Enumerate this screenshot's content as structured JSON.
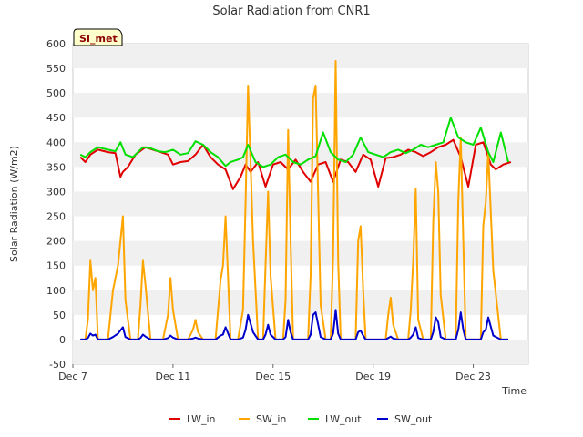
{
  "chart_data": {
    "type": "line",
    "title": "Solar Radiation from CNR1",
    "xlabel": "Time",
    "ylabel": "Solar Radiation (W/m2)",
    "site_badge": "SI_met",
    "ylim": [
      -50,
      600
    ],
    "xlim": [
      0,
      18.2
    ],
    "y_ticks": [
      -50,
      0,
      50,
      100,
      150,
      200,
      250,
      300,
      350,
      400,
      450,
      500,
      550,
      600
    ],
    "x_ticks": [
      {
        "value": 0,
        "label": "Dec 7"
      },
      {
        "value": 4,
        "label": "Dec 11"
      },
      {
        "value": 8,
        "label": "Dec 15"
      },
      {
        "value": 12,
        "label": "Dec 19"
      },
      {
        "value": 16,
        "label": "Dec 23"
      }
    ],
    "grid": true,
    "legend_position": "bottom",
    "series": [
      {
        "name": "LW_in",
        "color": "#e00000",
        "x": [
          0.3,
          0.5,
          0.7,
          1.0,
          1.4,
          1.7,
          1.9,
          2.0,
          2.2,
          2.5,
          2.9,
          3.2,
          3.5,
          3.8,
          4.0,
          4.3,
          4.6,
          4.9,
          5.2,
          5.5,
          5.8,
          6.1,
          6.4,
          6.7,
          6.9,
          7.1,
          7.4,
          7.7,
          8.0,
          8.3,
          8.6,
          8.9,
          9.2,
          9.5,
          9.8,
          10.1,
          10.4,
          10.7,
          11.0,
          11.3,
          11.6,
          11.9,
          12.2,
          12.5,
          12.8,
          13.1,
          13.4,
          13.7,
          14.0,
          14.3,
          14.6,
          14.9,
          15.2,
          15.5,
          15.8,
          16.1,
          16.4,
          16.7,
          16.9,
          17.2,
          17.5
        ],
        "values": [
          370,
          360,
          375,
          385,
          380,
          378,
          330,
          340,
          350,
          375,
          390,
          385,
          380,
          375,
          355,
          360,
          362,
          375,
          395,
          370,
          355,
          345,
          305,
          330,
          355,
          340,
          360,
          310,
          355,
          360,
          345,
          365,
          340,
          320,
          355,
          360,
          320,
          365,
          360,
          340,
          375,
          365,
          310,
          368,
          370,
          375,
          385,
          380,
          372,
          380,
          390,
          395,
          405,
          370,
          310,
          395,
          400,
          355,
          345,
          355,
          360
        ]
      },
      {
        "name": "SW_in",
        "color": "#ffa500",
        "x": [
          0.3,
          0.5,
          0.6,
          0.7,
          0.8,
          0.9,
          1.0,
          1.2,
          1.4,
          1.6,
          1.8,
          2.0,
          2.1,
          2.3,
          2.6,
          2.7,
          2.8,
          2.9,
          3.1,
          3.6,
          3.8,
          3.9,
          4.0,
          4.2,
          4.6,
          4.8,
          4.9,
          5.0,
          5.2,
          5.7,
          5.9,
          6.0,
          6.1,
          6.3,
          6.6,
          6.8,
          6.9,
          7.0,
          7.2,
          7.4,
          7.6,
          7.7,
          7.8,
          7.9,
          8.1,
          8.4,
          8.5,
          8.6,
          8.7,
          8.8,
          9.1,
          9.4,
          9.5,
          9.6,
          9.7,
          9.9,
          10.1,
          10.3,
          10.4,
          10.5,
          10.6,
          10.7,
          10.9,
          11.3,
          11.4,
          11.5,
          11.6,
          11.7,
          11.9,
          12.2,
          12.5,
          12.6,
          12.7,
          12.8,
          13.0,
          13.4,
          13.5,
          13.6,
          13.7,
          13.8,
          14.0,
          14.3,
          14.4,
          14.5,
          14.6,
          14.7,
          14.9,
          15.3,
          15.4,
          15.5,
          15.6,
          15.7,
          15.9,
          16.3,
          16.4,
          16.5,
          16.6,
          16.8,
          17.1,
          17.4
        ],
        "values": [
          0,
          0,
          40,
          160,
          100,
          125,
          0,
          0,
          0,
          100,
          150,
          250,
          80,
          0,
          0,
          70,
          160,
          110,
          0,
          0,
          50,
          125,
          60,
          0,
          0,
          20,
          40,
          15,
          0,
          0,
          120,
          150,
          250,
          0,
          0,
          60,
          280,
          515,
          200,
          0,
          0,
          150,
          300,
          130,
          0,
          0,
          80,
          425,
          200,
          0,
          0,
          0,
          130,
          490,
          515,
          70,
          0,
          0,
          170,
          565,
          160,
          0,
          0,
          0,
          200,
          230,
          100,
          0,
          0,
          0,
          0,
          50,
          85,
          30,
          0,
          0,
          60,
          160,
          305,
          40,
          0,
          0,
          240,
          360,
          300,
          90,
          0,
          0,
          280,
          410,
          200,
          0,
          0,
          0,
          230,
          280,
          380,
          140,
          0,
          0
        ]
      },
      {
        "name": "LW_out",
        "color": "#00e000",
        "x": [
          0.3,
          0.5,
          0.7,
          1.0,
          1.4,
          1.7,
          1.9,
          2.1,
          2.4,
          2.8,
          3.1,
          3.4,
          3.7,
          4.0,
          4.3,
          4.6,
          4.9,
          5.2,
          5.5,
          5.8,
          6.1,
          6.3,
          6.6,
          6.8,
          7.0,
          7.3,
          7.6,
          7.9,
          8.2,
          8.5,
          8.8,
          9.1,
          9.4,
          9.7,
          10.0,
          10.3,
          10.6,
          10.9,
          11.2,
          11.5,
          11.8,
          12.1,
          12.4,
          12.7,
          13.0,
          13.3,
          13.6,
          13.9,
          14.2,
          14.5,
          14.8,
          15.1,
          15.4,
          15.7,
          16.0,
          16.3,
          16.6,
          16.8,
          17.1,
          17.4
        ],
        "values": [
          375,
          370,
          380,
          390,
          385,
          382,
          400,
          375,
          370,
          390,
          388,
          382,
          380,
          385,
          375,
          378,
          402,
          395,
          380,
          370,
          352,
          360,
          365,
          370,
          395,
          360,
          350,
          355,
          370,
          375,
          360,
          355,
          365,
          372,
          420,
          380,
          365,
          360,
          375,
          410,
          380,
          375,
          370,
          380,
          385,
          378,
          385,
          395,
          390,
          395,
          400,
          450,
          410,
          400,
          395,
          430,
          380,
          360,
          420,
          360
        ]
      },
      {
        "name": "SW_out",
        "color": "#0000cc",
        "x": [
          0.3,
          0.5,
          0.6,
          0.7,
          0.8,
          0.9,
          1.0,
          1.2,
          1.4,
          1.6,
          1.8,
          2.0,
          2.1,
          2.3,
          2.6,
          2.7,
          2.8,
          2.9,
          3.1,
          3.6,
          3.8,
          3.9,
          4.0,
          4.2,
          4.6,
          4.8,
          4.9,
          5.0,
          5.2,
          5.7,
          5.9,
          6.0,
          6.1,
          6.3,
          6.6,
          6.8,
          6.9,
          7.0,
          7.2,
          7.4,
          7.6,
          7.7,
          7.8,
          7.9,
          8.1,
          8.4,
          8.5,
          8.6,
          8.7,
          8.8,
          9.1,
          9.4,
          9.5,
          9.6,
          9.7,
          9.9,
          10.1,
          10.3,
          10.4,
          10.5,
          10.6,
          10.7,
          10.9,
          11.3,
          11.4,
          11.5,
          11.6,
          11.7,
          11.9,
          12.2,
          12.5,
          12.6,
          12.7,
          12.8,
          13.0,
          13.4,
          13.5,
          13.6,
          13.7,
          13.8,
          14.0,
          14.3,
          14.4,
          14.5,
          14.6,
          14.7,
          14.9,
          15.3,
          15.4,
          15.5,
          15.6,
          15.7,
          15.9,
          16.3,
          16.4,
          16.5,
          16.6,
          16.8,
          17.1,
          17.4
        ],
        "values": [
          0,
          0,
          3,
          12,
          8,
          10,
          0,
          0,
          0,
          5,
          12,
          25,
          5,
          0,
          0,
          3,
          10,
          6,
          0,
          0,
          3,
          8,
          4,
          0,
          0,
          2,
          4,
          2,
          0,
          0,
          8,
          10,
          25,
          0,
          0,
          4,
          20,
          50,
          15,
          0,
          0,
          10,
          30,
          10,
          0,
          0,
          5,
          40,
          15,
          0,
          0,
          0,
          10,
          50,
          55,
          5,
          0,
          0,
          12,
          60,
          12,
          0,
          0,
          0,
          15,
          18,
          8,
          0,
          0,
          0,
          0,
          3,
          6,
          2,
          0,
          0,
          4,
          10,
          25,
          3,
          0,
          0,
          15,
          45,
          35,
          5,
          0,
          0,
          20,
          55,
          20,
          0,
          0,
          0,
          15,
          20,
          45,
          8,
          0,
          0
        ]
      }
    ]
  }
}
